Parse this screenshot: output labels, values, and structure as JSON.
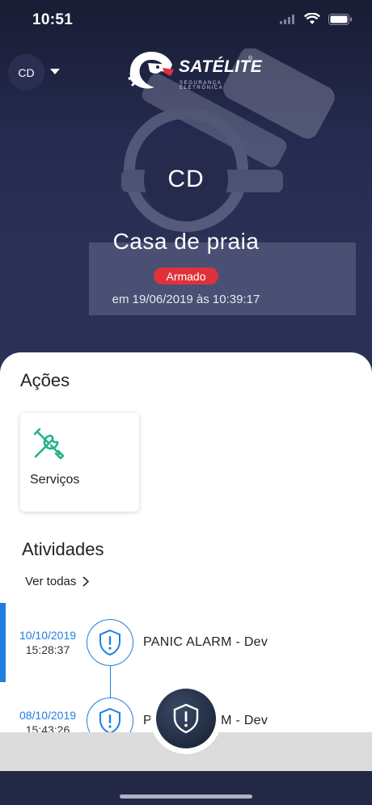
{
  "status_bar": {
    "time": "10:51"
  },
  "header": {
    "account_chip": "CD",
    "logo": {
      "brand": "SATÉLITE",
      "tagline": "SEGURANÇA ELETRÔNICA",
      "registered": "®"
    },
    "avatar_initials": "CD",
    "place_name": "Casa de praia",
    "status": "Armado",
    "status_color": "#e0313a",
    "timestamp": "em 19/06/2019 às 10:39:17"
  },
  "actions": {
    "title": "Ações",
    "items": [
      {
        "label": "Serviços",
        "icon": "tools-icon"
      }
    ]
  },
  "activities": {
    "title": "Atividades",
    "see_all": "Ver todas",
    "items": [
      {
        "date": "10/10/2019",
        "time": "15:28:37",
        "label": "PANIC ALARM  - Dev",
        "icon": "shield-alert-icon"
      },
      {
        "date": "08/10/2019",
        "time": "15:43:26",
        "label": "PANIC ALARM  - Dev",
        "icon": "shield-alert-icon"
      }
    ]
  },
  "fab": {
    "icon": "shield-alert-icon"
  },
  "colors": {
    "accent": "#1e7fe0",
    "tool_green": "#26b08a",
    "header_bg": "#252a4f"
  }
}
